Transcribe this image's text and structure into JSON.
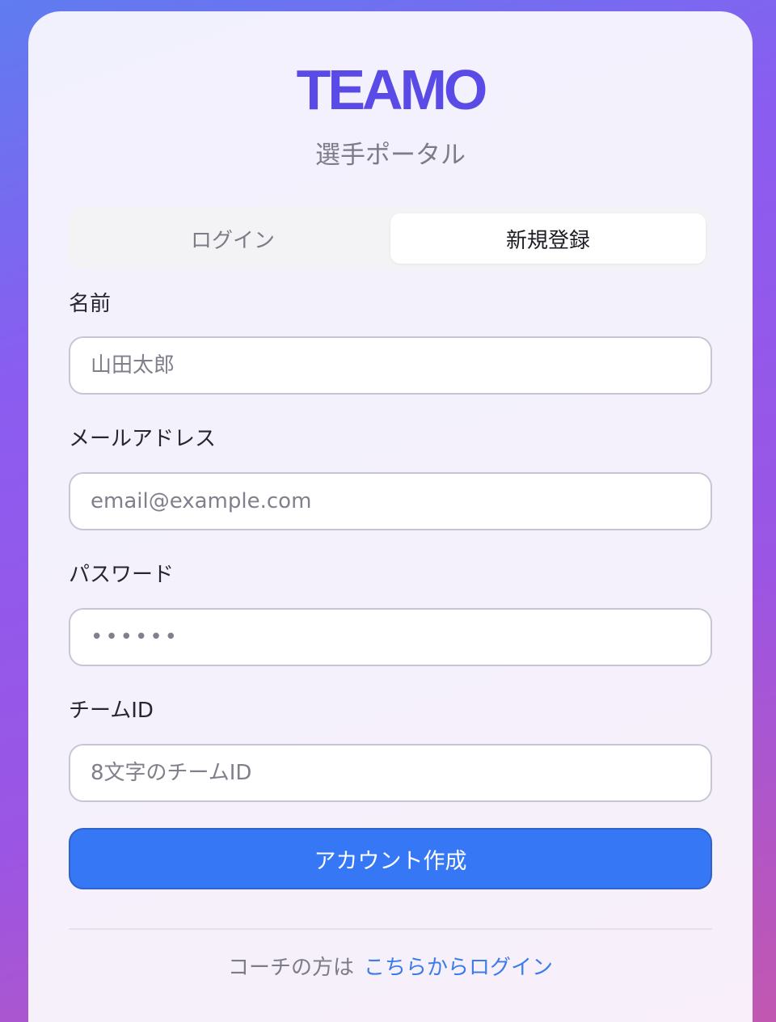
{
  "brand": {
    "logo_text": "TEAMO",
    "subtitle": "選手ポータル",
    "accent_color": "#5b4be6",
    "button_color": "#3577f5",
    "link_color": "#3b7bea"
  },
  "tabs": [
    {
      "label": "ログイン",
      "active": false
    },
    {
      "label": "新規登録",
      "active": true
    }
  ],
  "form": {
    "name": {
      "label": "名前",
      "value": "",
      "placeholder": "山田太郎"
    },
    "email": {
      "label": "メールアドレス",
      "value": "",
      "placeholder": "email@example.com"
    },
    "password": {
      "label": "パスワード",
      "value": "",
      "placeholder": "••••••"
    },
    "team_id": {
      "label": "チームID",
      "value": "",
      "placeholder": "8文字のチームID"
    },
    "submit_label": "アカウント作成"
  },
  "footer": {
    "text": "コーチの方は",
    "link_label": "こちらからログイン"
  }
}
